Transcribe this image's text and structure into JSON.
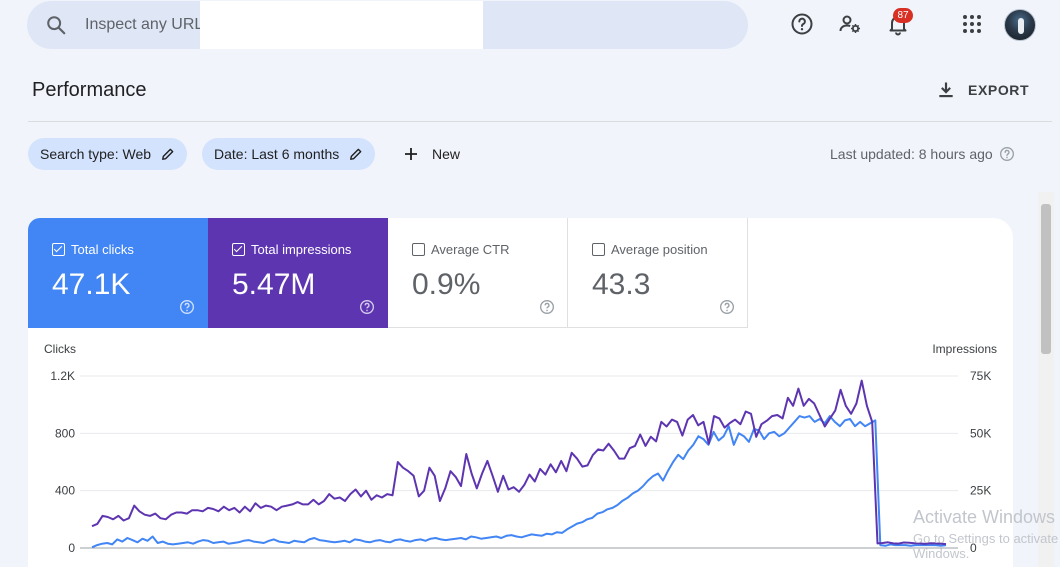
{
  "search": {
    "placeholder": "Inspect any URL"
  },
  "topbar": {
    "notification_count": "87"
  },
  "header": {
    "title": "Performance",
    "export_label": "EXPORT"
  },
  "filters": {
    "chips": [
      {
        "label": "Search type: Web"
      },
      {
        "label": "Date: Last 6 months"
      }
    ],
    "new_label": "New",
    "last_updated": "Last updated: 8 hours ago"
  },
  "metrics": [
    {
      "label": "Total clicks",
      "value": "47.1K",
      "selected": true,
      "color": "#4285f4"
    },
    {
      "label": "Total impressions",
      "value": "5.47M",
      "selected": true,
      "color": "#5e35b1"
    },
    {
      "label": "Average CTR",
      "value": "0.9%",
      "selected": false,
      "color": "#00897b"
    },
    {
      "label": "Average position",
      "value": "43.3",
      "selected": false,
      "color": "#e8710a"
    }
  ],
  "watermark": {
    "line1": "Activate Windows",
    "line2": "Go to Settings to activate Windows."
  },
  "chart_data": {
    "type": "line",
    "left_axis": {
      "label": "Clicks",
      "ticks": [
        "0",
        "400",
        "800",
        "1.2K"
      ],
      "range": [
        0,
        1200
      ]
    },
    "right_axis": {
      "label": "Impressions",
      "ticks": [
        "0",
        "25K",
        "50K",
        "75K"
      ],
      "range": [
        0,
        75000
      ]
    },
    "grid": true,
    "series": [
      {
        "axis": "left",
        "color": "#4285f4",
        "values": [
          5,
          20,
          30,
          35,
          25,
          60,
          45,
          70,
          55,
          40,
          65,
          50,
          80,
          35,
          45,
          30,
          25,
          30,
          35,
          40,
          30,
          45,
          55,
          50,
          35,
          40,
          45,
          30,
          35,
          40,
          50,
          55,
          45,
          40,
          35,
          50,
          60,
          45,
          40,
          35,
          50,
          45,
          40,
          60,
          70,
          55,
          50,
          45,
          40,
          45,
          50,
          40,
          60,
          55,
          45,
          40,
          50,
          55,
          45,
          40,
          55,
          60,
          50,
          45,
          55,
          60,
          50,
          65,
          70,
          60,
          55,
          60,
          65,
          70,
          60,
          80,
          75,
          65,
          70,
          75,
          80,
          70,
          85,
          90,
          80,
          75,
          85,
          95,
          90,
          85,
          100,
          95,
          110,
          105,
          130,
          150,
          170,
          180,
          200,
          210,
          240,
          250,
          270,
          280,
          300,
          330,
          350,
          380,
          400,
          430,
          470,
          500,
          520,
          470,
          540,
          600,
          650,
          620,
          680,
          720,
          780,
          760,
          720,
          810,
          750,
          780,
          850,
          720,
          800,
          780,
          740,
          830,
          820,
          760,
          800,
          810,
          780,
          800,
          840,
          880,
          920,
          910,
          920,
          880,
          900,
          870,
          920,
          880,
          850,
          890,
          900,
          850,
          880,
          850,
          870,
          890,
          20,
          15,
          25,
          20,
          20,
          20,
          15,
          20,
          20,
          20,
          20,
          20,
          15,
          20
        ],
        "note": "clicks per day (approx)"
      },
      {
        "axis": "right",
        "color": "#5e35b1",
        "values": [
          9500,
          10500,
          14000,
          13500,
          12500,
          14000,
          12000,
          13000,
          18500,
          16000,
          14500,
          14000,
          15000,
          13000,
          12500,
          14500,
          15500,
          15500,
          15000,
          16500,
          16500,
          16000,
          17500,
          17000,
          16000,
          18000,
          16500,
          17500,
          15500,
          18000,
          16000,
          19500,
          17500,
          18500,
          18000,
          16500,
          18000,
          18500,
          19000,
          20000,
          19000,
          19000,
          21000,
          19000,
          20500,
          23500,
          21500,
          22000,
          20500,
          23500,
          25500,
          22500,
          25000,
          21000,
          23000,
          22000,
          23500,
          23000,
          37500,
          35000,
          33500,
          31500,
          22500,
          25000,
          35000,
          31500,
          20500,
          26000,
          33500,
          31000,
          27000,
          41000,
          32500,
          26000,
          32500,
          38000,
          31500,
          24500,
          31500,
          25500,
          26500,
          24500,
          27500,
          32000,
          29000,
          34500,
          32000,
          36500,
          33000,
          38000,
          33500,
          41500,
          39000,
          35500,
          36000,
          40500,
          43000,
          42500,
          45500,
          42500,
          39000,
          39000,
          43500,
          44500,
          49500,
          44500,
          48500,
          46500,
          55000,
          53000,
          56000,
          55000,
          49000,
          56000,
          58000,
          53500,
          55000,
          45500,
          57500,
          56500,
          52500,
          54500,
          56000,
          54000,
          59500,
          58500,
          48500,
          54000,
          55500,
          57500,
          58000,
          56500,
          65500,
          62000,
          69500,
          62000,
          65000,
          63000,
          58000,
          53000,
          56500,
          60000,
          69000,
          62000,
          58500,
          63000,
          73000,
          62000,
          55000,
          2000,
          2200,
          2500,
          2000,
          1900,
          2400,
          2300,
          2100,
          2000,
          1800,
          2100,
          2000,
          1900,
          1700
        ],
        "note": "impressions per day (approx)"
      }
    ]
  }
}
